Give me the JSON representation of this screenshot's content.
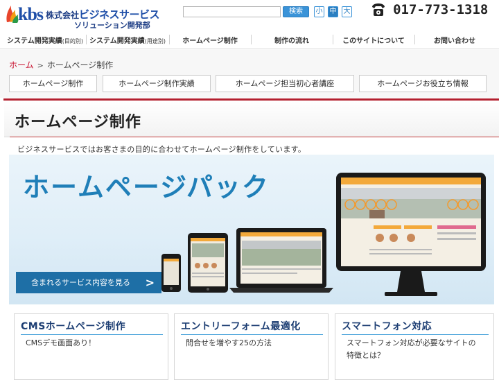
{
  "header": {
    "logo_text": "kbs",
    "company_prefix": "株式会社",
    "company_brand": "ビジネスサービス",
    "division": "ソリューション開発部",
    "search_placeholder": "",
    "search_button": "検索",
    "font_sizes": [
      "小",
      "中",
      "大"
    ],
    "phone_icon": "telephone-icon",
    "phone_number": "017-773-1318"
  },
  "nav": {
    "items": [
      {
        "label": "システム開発実績",
        "note": "(目的別)"
      },
      {
        "label": "システム開発実績",
        "note": "(用途別)"
      },
      {
        "label": "ホームページ制作",
        "note": ""
      },
      {
        "label": "制作の流れ",
        "note": ""
      },
      {
        "label": "このサイトについて",
        "note": ""
      },
      {
        "label": "お問い合わせ",
        "note": ""
      }
    ]
  },
  "breadcrumb": {
    "home": "ホーム",
    "separator": ">",
    "current": "ホームページ制作"
  },
  "subnav": {
    "items": [
      "ホームページ制作",
      "ホームページ制作実績",
      "ホームページ担当初心者講座",
      "ホームページお役立ち情報"
    ]
  },
  "page": {
    "title": "ホームページ制作",
    "intro": "ビジネスサービスではお客さまの目的に合わせてホームページ制作をしています。"
  },
  "hero": {
    "title": "ホームページパック",
    "cta": "含まれるサービス内容を見る",
    "cta_arrow": ">"
  },
  "features": [
    {
      "title": "CMSホームページ制作",
      "text": "CMSデモ画面あり！"
    },
    {
      "title": "エントリーフォーム最適化",
      "text": "問合せを増やす25の方法"
    },
    {
      "title": "スマートフォン対応",
      "text": "スマートフォン対応が必要なサイトの特徴とは？"
    }
  ],
  "colors": {
    "accent_red": "#b31f2e",
    "link_red": "#c8102e",
    "brand_blue": "#1f4fa8",
    "hero_blue": "#1f7fb8",
    "cta_blue": "#1e6fa6"
  }
}
